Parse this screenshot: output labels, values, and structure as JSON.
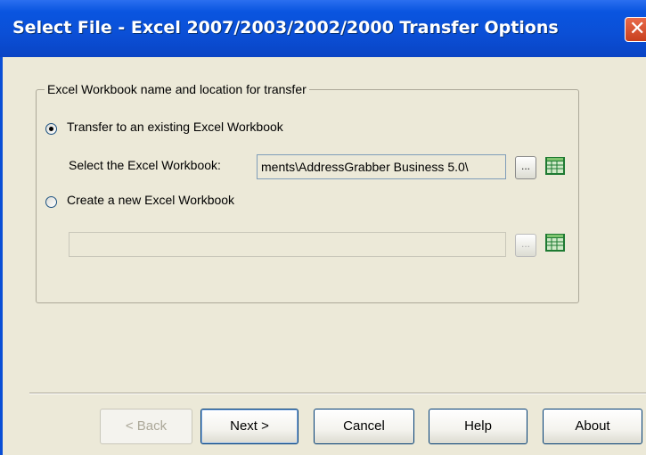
{
  "window": {
    "title": "Select File - Excel 2007/2003/2002/2000 Transfer Options",
    "close_glyph": "✕"
  },
  "group": {
    "title": "Excel Workbook name and location for transfer"
  },
  "options": {
    "existing": {
      "label": "Transfer to an existing Excel Workbook",
      "selected": true,
      "select_label": "Select the Excel Workbook:",
      "path_value": "ments\\AddressGrabber Business 5.0\\",
      "browse_label": "...",
      "icon": "excel-workbook-icon"
    },
    "new": {
      "label": "Create a new Excel Workbook",
      "selected": false,
      "path_value": "",
      "browse_label": "...",
      "icon": "excel-workbook-icon"
    }
  },
  "buttons": {
    "back": "< Back",
    "next": "Next >",
    "cancel": "Cancel",
    "help": "Help",
    "about": "About"
  },
  "colors": {
    "titlebar": "#0b4fd6",
    "dialog_bg": "#ece9d8",
    "excel_icon": "#1e7a32"
  }
}
